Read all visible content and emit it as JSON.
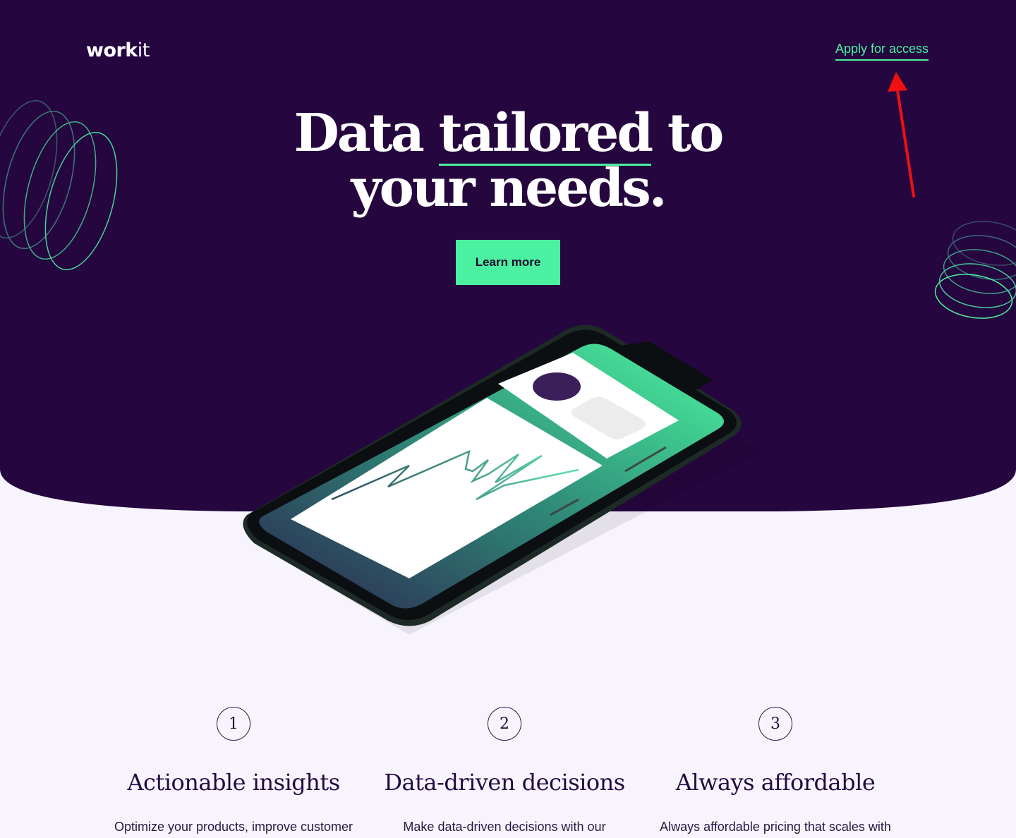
{
  "brand": {
    "logo_bold": "work",
    "logo_light": "it"
  },
  "nav": {
    "apply_label": "Apply for access"
  },
  "hero": {
    "title_part1": "Data ",
    "title_underlined": "tailored",
    "title_part2": " to",
    "title_line2": "your needs.",
    "cta_label": "Learn more"
  },
  "features": [
    {
      "number": "1",
      "title": "Actionable insights",
      "desc": "Optimize your products, improve customer"
    },
    {
      "number": "2",
      "title": "Data-driven decisions",
      "desc": "Make data-driven decisions with our"
    },
    {
      "number": "3",
      "title": "Always affordable",
      "desc": "Always affordable pricing that scales with"
    }
  ],
  "colors": {
    "hero_bg": "#26063f",
    "accent": "#4bf0a0",
    "page_bg": "#f7f4fe",
    "annotation": "#ee1111"
  },
  "icons": [
    "coil-decoration-left",
    "coil-decoration-right",
    "annotation-arrow",
    "phone-illustration",
    "zigzag-chart",
    "avatar-circle"
  ]
}
